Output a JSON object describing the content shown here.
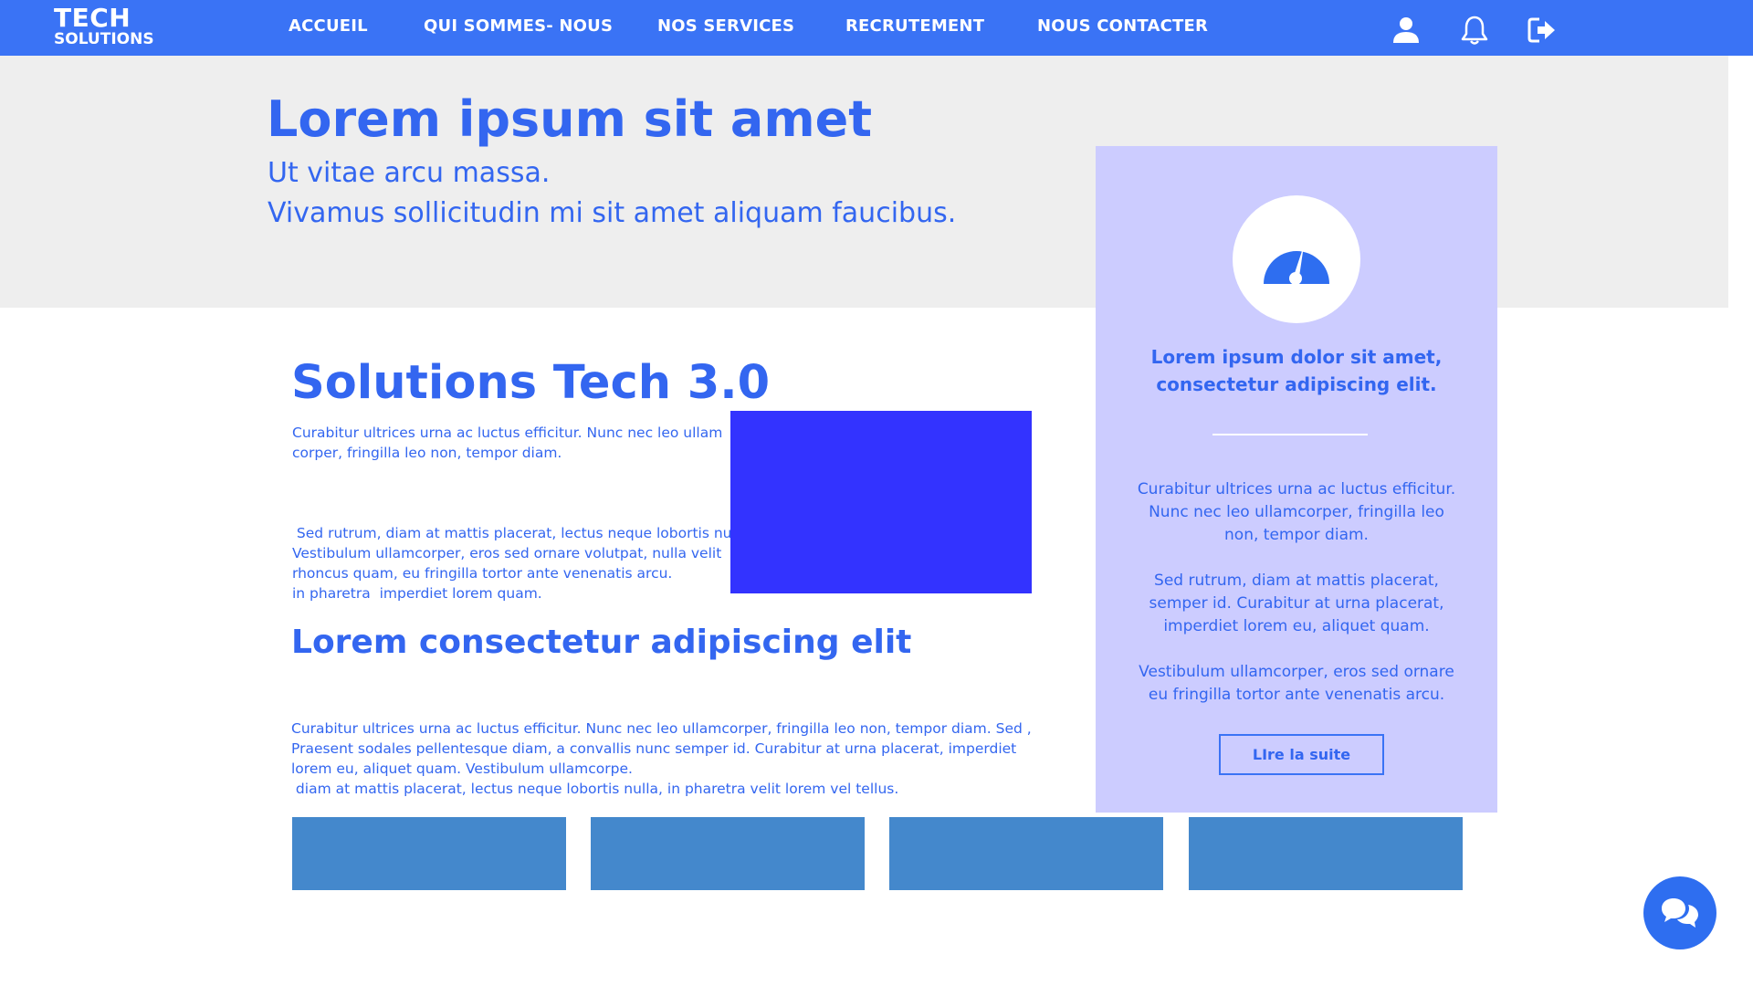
{
  "brand": {
    "line1": "TECH",
    "line2": "SOLUTIONS"
  },
  "nav": {
    "items": [
      {
        "label": "ACCUEIL"
      },
      {
        "label": "QUI SOMMES- NOUS"
      },
      {
        "label": "NOS SERVICES"
      },
      {
        "label": "RECRUTEMENT"
      },
      {
        "label": "NOUS CONTACTER"
      }
    ],
    "icons": [
      "user-icon",
      "bell-icon",
      "logout-icon"
    ]
  },
  "hero": {
    "title": "Lorem ipsum sit amet",
    "subtitle_line1": "Ut vitae arcu massa.",
    "subtitle_line2": "Vivamus sollicitudin mi sit amet aliquam faucibus."
  },
  "main": {
    "title": "Solutions Tech 3.0",
    "paragraphs": [
      {
        "line1": "Curabitur ultrices urna ac luctus efficitur. Nunc nec leo ullam",
        "line2": "corper, fringilla leo non, tempor diam."
      },
      {
        "line1": " Sed rutrum, diam at mattis placerat, lectus neque lobortis nulla,",
        "line2": "in pharetra  imperdiet lorem quam."
      },
      {
        "line1": "Vestibulum ullamcorper, eros sed ornare volutpat, nulla velit",
        "line2": "rhoncus quam, eu fringilla tortor ante venenatis arcu."
      }
    ],
    "subtitle": "Lorem consectetur adipiscing elit",
    "sub_paragraphs": [
      {
        "line1": "Curabitur ultrices urna ac luctus efficitur. Nunc nec leo ullamcorper, fringilla leo non, tempor diam. Sed ,",
        "line2": " diam at mattis placerat, lectus neque lobortis nulla, in pharetra velit lorem vel tellus."
      },
      {
        "line1": "Praesent sodales pellentesque diam, a convallis nunc semper id. Curabitur at urna placerat, imperdiet",
        "line2": "lorem eu, aliquet quam. Vestibulum ullamcorpe."
      }
    ]
  },
  "card": {
    "icon": "dashboard-gauge-icon",
    "heading_line1": "Lorem ipsum dolor sit amet,",
    "heading_line2": "consectetur adipiscing elit.",
    "paragraphs": [
      {
        "line1": "Curabitur ultrices urna ac luctus efficitur.",
        "line2": "Nunc nec leo ullamcorper, fringilla leo",
        "line3": "non, tempor diam."
      },
      {
        "line1": "Sed rutrum, diam at mattis placerat,",
        "line2": "semper id. Curabitur at urna placerat,",
        "line3": "imperdiet lorem eu, aliquet quam."
      },
      {
        "line1": "Vestibulum ullamcorper, eros sed ornare",
        "line2": "eu fringilla tortor ante venenatis arcu."
      }
    ],
    "button_label": "LIre la suite"
  },
  "tiles_count": 4,
  "chat": {
    "icon": "chat-bubbles-icon"
  },
  "colors": {
    "nav_bg": "#3a73f5",
    "text_accent": "#3366f0",
    "hero_bg": "#eeeeee",
    "card_bg": "#ccccff",
    "media_block": "#3333ff",
    "tile": "#4488cc",
    "chat_button": "#2e6ef0"
  }
}
